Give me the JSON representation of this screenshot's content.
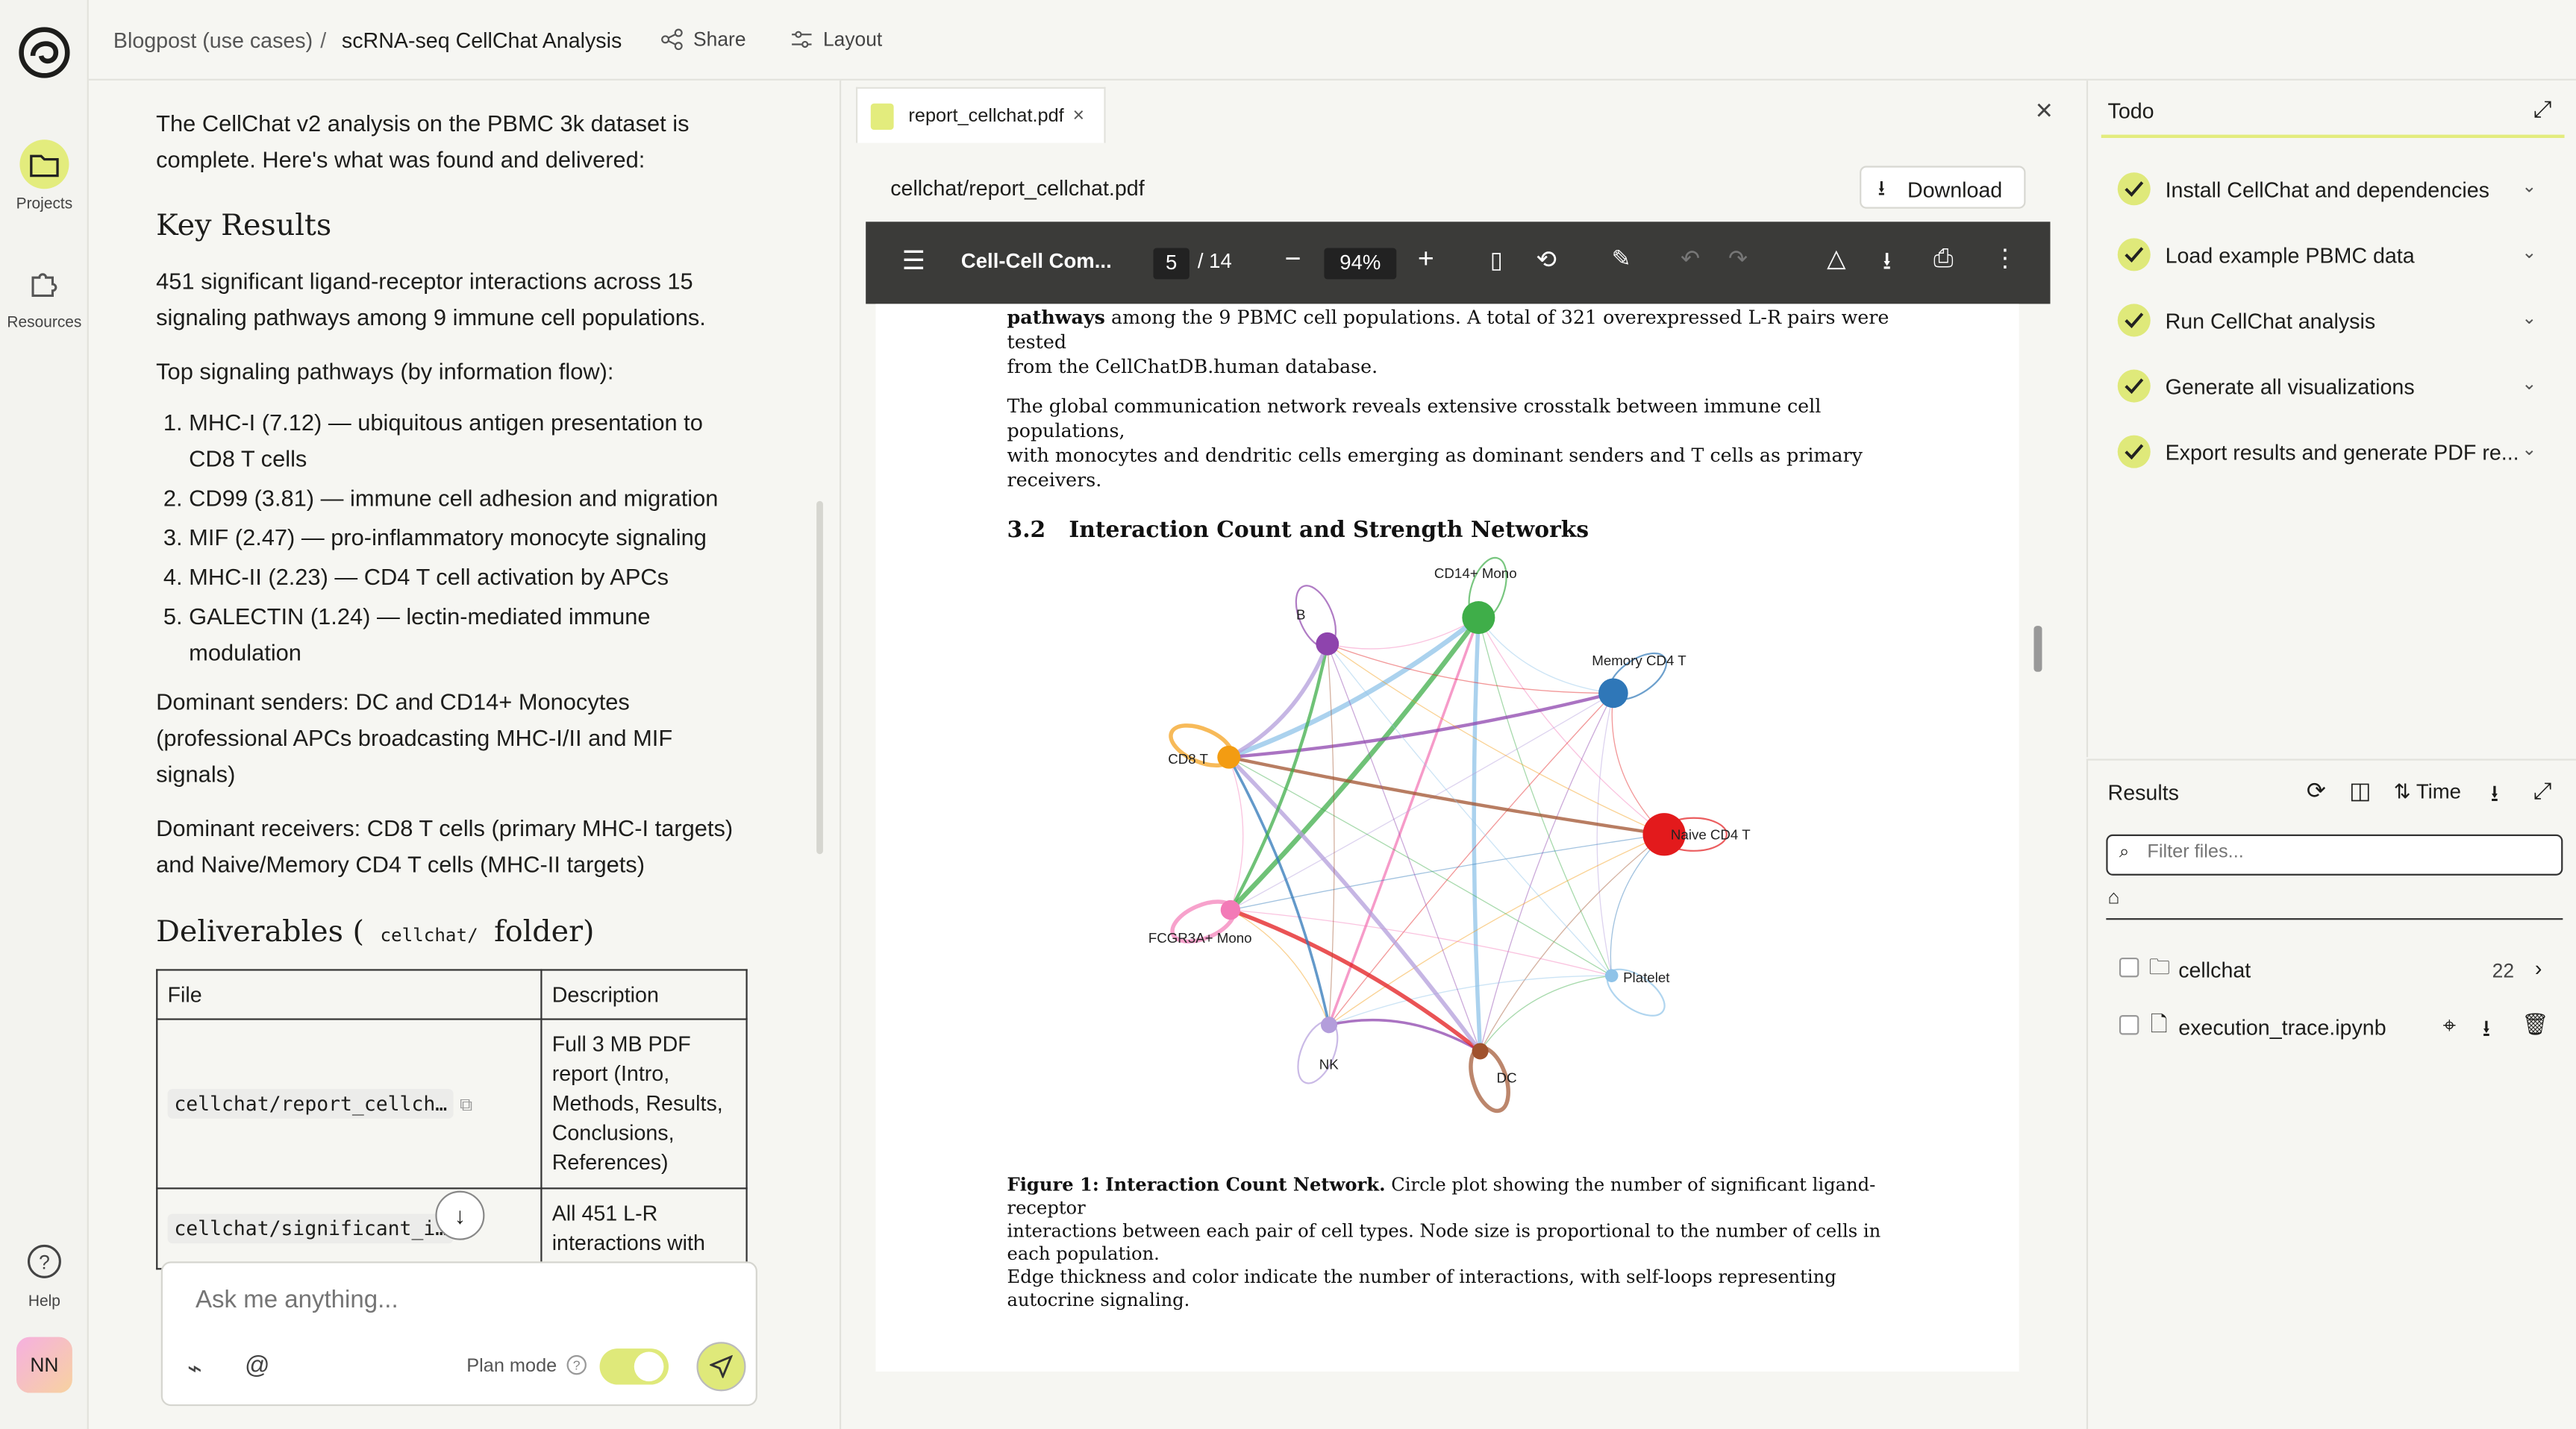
{
  "rail": {
    "projects": "Projects",
    "resources": "Resources",
    "help": "Help",
    "avatar": "NN"
  },
  "header": {
    "breadcrumb_parent": "Blogpost (use cases)",
    "separator": "/",
    "breadcrumb_current": "scRNA-seq CellChat Analysis",
    "share": "Share",
    "layout": "Layout"
  },
  "chat": {
    "intro": "The CellChat v2 analysis on the PBMC 3k dataset is complete. Here's what was found and delivered:",
    "key_results_heading": "Key Results",
    "summary": "451 significant ligand-receptor interactions across 15 signaling pathways among 9 immune cell populations.",
    "top_pathways_label": "Top signaling pathways (by information flow):",
    "pathways": [
      "MHC-I (7.12) — ubiquitous antigen presentation to CD8 T cells",
      "CD99 (3.81) — immune cell adhesion and migration",
      "MIF (2.47) — pro-inflammatory monocyte signaling",
      "MHC-II (2.23) — CD4 T cell activation by APCs",
      "GALECTIN (1.24) — lectin-mediated immune modulation"
    ],
    "senders": "Dominant senders: DC and CD14+ Monocytes (professional APCs broadcasting MHC-I/II and MIF signals)",
    "receivers": "Dominant receivers: CD8 T cells (primary MHC-I targets) and Naive/Memory CD4 T cells (MHC-II targets)",
    "deliverables_pre": "Deliverables (",
    "deliverables_code": "cellchat/",
    "deliverables_post": "folder)",
    "table": {
      "col_file": "File",
      "col_desc": "Description",
      "rows": [
        {
          "file": "cellchat/report_cellch…",
          "desc": "Full 3 MB PDF report (Intro, Methods, Results, Conclusions, References)"
        },
        {
          "file": "cellchat/significant_i…",
          "desc": "All 451 L-R interactions with"
        }
      ]
    },
    "composer_placeholder": "Ask me anything...",
    "plan_mode": "Plan mode",
    "plan_mode_on": true
  },
  "viewer": {
    "tab_label": "report_cellchat.pdf",
    "path": "cellchat/report_cellchat.pdf",
    "download": "Download",
    "doc_title": "Cell-Cell Com...",
    "page_current": "5",
    "page_total": "/ 14",
    "zoom": "94%",
    "text_top_bold": "pathways",
    "text_top_rest": " among the 9 PBMC cell populations. A total of 321 overexpressed L-R pairs were tested",
    "text_top_line2": "from the CellChatDB.human database.",
    "para1_l1": "The global communication network reveals extensive crosstalk between immune cell populations,",
    "para1_l2": "with monocytes and dendritic cells emerging as dominant senders and T cells as primary receivers.",
    "section_num": "3.2",
    "section_title": "Interaction Count and Strength Networks",
    "nodes": [
      {
        "name": "CD14+ Mono",
        "color": "#3fae49"
      },
      {
        "name": "Memory CD4 T",
        "color": "#2f77b8"
      },
      {
        "name": "Naive CD4 T",
        "color": "#e31a1c"
      },
      {
        "name": "Platelet",
        "color": "#8fc3e8"
      },
      {
        "name": "DC",
        "color": "#a0522d"
      },
      {
        "name": "NK",
        "color": "#b39ddb"
      },
      {
        "name": "FCGR3A+ Mono",
        "color": "#f37ab7"
      },
      {
        "name": "CD8 T",
        "color": "#f39c12"
      },
      {
        "name": "B",
        "color": "#8e44ad"
      }
    ],
    "caption_label": "Figure 1:  Interaction Count Network.",
    "caption_l1": " Circle plot showing the number of significant ligand-receptor",
    "caption_l2": "interactions between each pair of cell types. Node size is proportional to the number of cells in each population.",
    "caption_l3": "Edge thickness and color indicate the number of interactions, with self-loops representing autocrine signaling."
  },
  "todo": {
    "title": "Todo",
    "items": [
      "Install CellChat and dependencies",
      "Load example PBMC data",
      "Run CellChat analysis",
      "Generate all visualizations",
      "Export results and generate PDF re..."
    ]
  },
  "results": {
    "title": "Results",
    "sort": "Time",
    "filter_placeholder": "Filter files...",
    "files": [
      {
        "name": "cellchat",
        "count": "22"
      },
      {
        "name": "execution_trace.ipynb"
      }
    ]
  }
}
